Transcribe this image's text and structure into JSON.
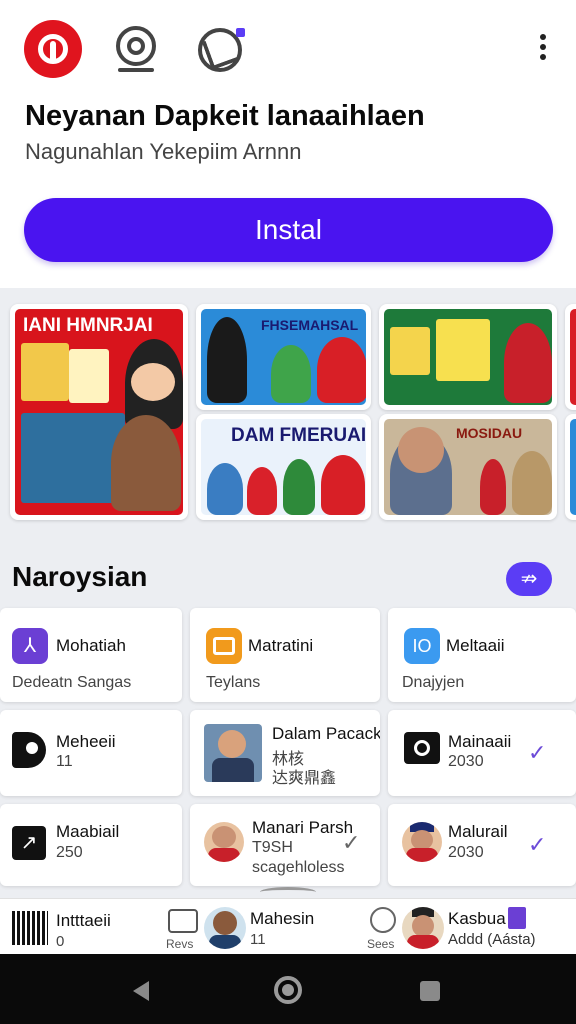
{
  "header": {
    "icons": [
      "app-logo-icon",
      "camera-icon",
      "globe-icon",
      "more-icon"
    ]
  },
  "app": {
    "title": "Neyanan Dapkeit lanaaihlaen",
    "subtitle": "Nagunahlan Yekepiim Arnnn",
    "install_label": "Instal"
  },
  "screenshots": [
    {
      "caption": "IANI HMNRJAI"
    },
    {
      "caption": "FHSEMAHSAL"
    },
    {
      "caption": ""
    },
    {
      "caption": "DAM FMERUAI"
    },
    {
      "caption": "MOSIDAU"
    }
  ],
  "section": {
    "title": "Naroysian",
    "arrow_icon": "double-arrow-icon"
  },
  "cards": [
    {
      "title": "Mohatiah",
      "sub": "Dedeatn Sangas",
      "icon": "app-icon-purple"
    },
    {
      "title": "Matratini",
      "sub": "Teylans",
      "icon": "app-icon-orange"
    },
    {
      "title": "Meltaaii",
      "sub": "Dnajyjen",
      "icon": "app-icon-blue"
    },
    {
      "title": "Meheeii",
      "sub": "11",
      "icon": "tag-icon"
    },
    {
      "title": "Dalam Pacack",
      "sub": "林核",
      "sub2": "达爽鼎鑫",
      "icon": "photo-thumb"
    },
    {
      "title": "Mainaaii",
      "sub": "2030",
      "icon": "camera-icon",
      "checked": true
    },
    {
      "title": "Maabiail",
      "sub": "250",
      "icon": "chart-icon"
    },
    {
      "title": "Manari Parsh",
      "sub": "T9SH",
      "sub2": "scagehloless",
      "icon": "avatar",
      "checked": true
    },
    {
      "title": "Malurail",
      "sub": "2030",
      "icon": "avatar",
      "checked": true
    }
  ],
  "bottom_nav": [
    {
      "title": "Intttaeii",
      "val": "0",
      "icon": "barcode-icon"
    },
    {
      "small": "Revs",
      "icon": "image-icon"
    },
    {
      "title": "Mahesin",
      "val": "11",
      "icon": "avatar"
    },
    {
      "small": "Sees",
      "icon": "search-icon"
    },
    {
      "title": "Kasbua",
      "val": "Addd (Aásta)",
      "icon": "bookmark-icon"
    }
  ],
  "colors": {
    "accent": "#4a14f0",
    "brand_red": "#e0141e",
    "check": "#6c4bd8"
  }
}
